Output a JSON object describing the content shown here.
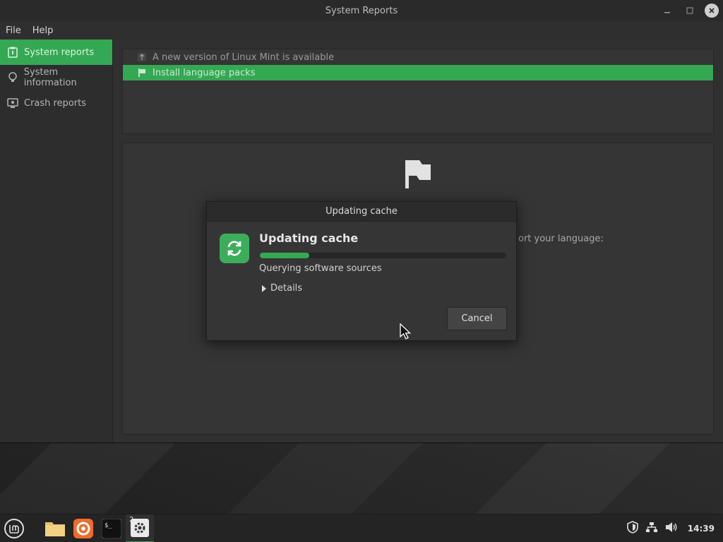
{
  "window": {
    "title": "System Reports",
    "menu": [
      "File",
      "Help"
    ]
  },
  "sidebar": {
    "items": [
      {
        "label": "System reports",
        "icon": "report-icon",
        "active": true
      },
      {
        "label": "System information",
        "icon": "lightbulb-icon",
        "active": false
      },
      {
        "label": "Crash reports",
        "icon": "monitor-bug-icon",
        "active": false
      }
    ]
  },
  "reports": [
    {
      "label": "A new version of Linux Mint is available",
      "icon": "upgrade-arrow-icon",
      "selected": false
    },
    {
      "label": "Install language packs",
      "icon": "flag-icon",
      "selected": true
    }
  ],
  "detail": {
    "partial_text": "ort your language:"
  },
  "dialog": {
    "title": "Updating cache",
    "heading": "Updating cache",
    "progress": 0.2,
    "status": "Querying software sources",
    "details_label": "Details",
    "cancel_label": "Cancel"
  },
  "taskbar": {
    "apps": [
      {
        "name": "files-icon"
      },
      {
        "name": "firefox-icon"
      },
      {
        "name": "terminal-icon"
      },
      {
        "name": "settings-icon",
        "badge": "2",
        "active": true
      }
    ],
    "clock": "14:39"
  },
  "colors": {
    "accent": "#35a854"
  }
}
